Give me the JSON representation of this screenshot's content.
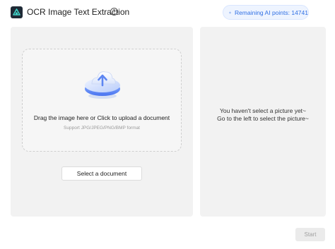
{
  "app": {
    "title": "OCR Image Text Extraction",
    "help_symbol": "?"
  },
  "header": {
    "points_label": "Remaining AI points: 14741",
    "accent_color": "#2f6fe4"
  },
  "upload": {
    "drop_title": "Drag the image here or Click to upload a document",
    "drop_hint": "Support JPG/JPEG/PNG/BMP format",
    "select_button": "Select a document"
  },
  "preview": {
    "empty_line1": "You haven't select a picture yet~",
    "empty_line2": "Go to the left to select the picture~"
  },
  "footer": {
    "start_button": "Start"
  }
}
